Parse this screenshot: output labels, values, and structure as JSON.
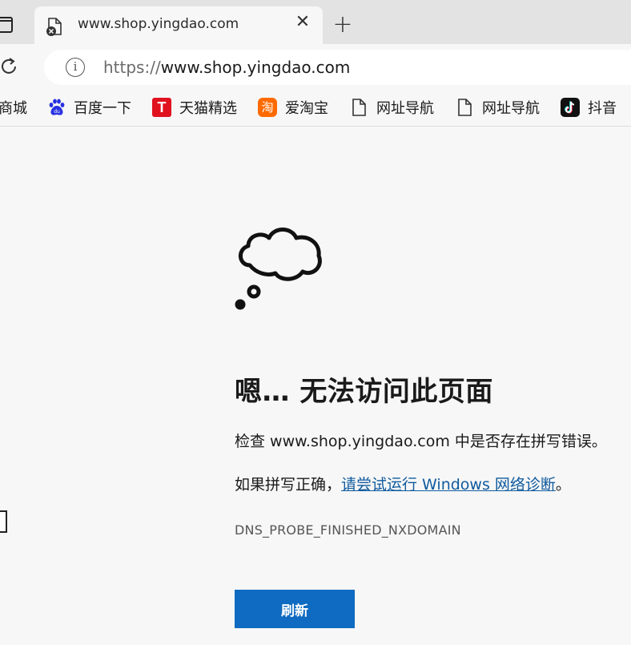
{
  "tab": {
    "title": "www.shop.yingdao.com",
    "close_glyph": "✕",
    "new_tab_glyph": "+"
  },
  "address_bar": {
    "info_glyph": "i",
    "url_scheme": "https://",
    "url_host": "www.shop.yingdao.com"
  },
  "bookmarks": [
    {
      "label": "商城",
      "icon": "none"
    },
    {
      "label": "百度一下",
      "icon": "baidu-paw-icon"
    },
    {
      "label": "天猫精选",
      "icon": "tmall-icon",
      "glyph": "T"
    },
    {
      "label": "爱淘宝",
      "icon": "taobao-icon",
      "glyph": "淘"
    },
    {
      "label": "网址导航",
      "icon": "page-icon"
    },
    {
      "label": "网址导航",
      "icon": "page-icon"
    },
    {
      "label": "抖音",
      "icon": "tiktok-icon"
    }
  ],
  "error_page": {
    "heading": "嗯… 无法访问此页面",
    "line1": "检查 www.shop.yingdao.com 中是否存在拼写错误。",
    "line2_prefix": "如果拼写正确，",
    "line2_link": "请尝试运行 Windows 网络诊断",
    "line2_suffix": "。",
    "error_code": "DNS_PROBE_FINISHED_NXDOMAIN",
    "refresh_button": "刷新"
  },
  "colors": {
    "accent_button": "#0e6bc1",
    "link": "#0f5a9e",
    "page_bg": "#f7f7f7",
    "tabstrip_bg": "#e3e3e3"
  }
}
